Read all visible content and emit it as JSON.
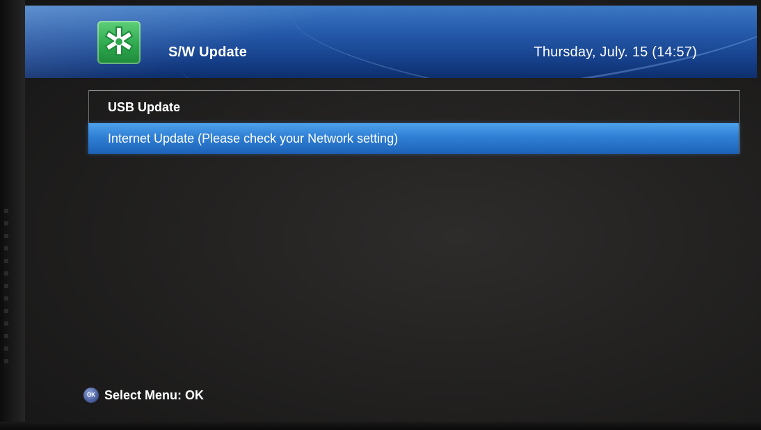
{
  "header": {
    "title": "S/W Update",
    "datetime": "Thursday, July. 15 (14:57)",
    "icon": "settings-update-icon"
  },
  "menu": {
    "items": [
      {
        "label": "USB Update",
        "selected": false
      },
      {
        "label": "Internet Update (Please check your Network setting)",
        "selected": true
      }
    ]
  },
  "footer": {
    "ok_badge": "OK",
    "hint": "Select Menu: OK"
  },
  "colors": {
    "header_blue": "#2458a8",
    "highlight_blue": "#2f7fd4",
    "icon_green": "#2fa84e"
  }
}
